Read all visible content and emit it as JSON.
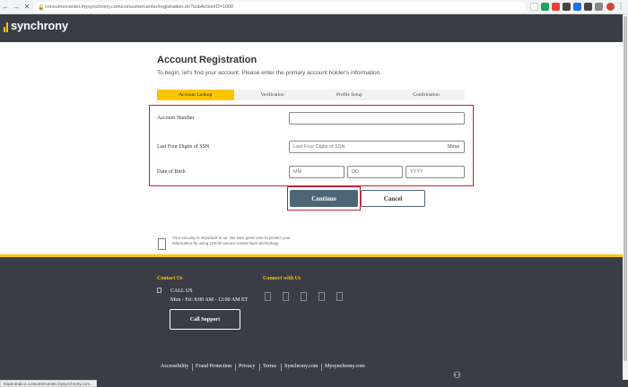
{
  "browser": {
    "url": "consumercenter.mysynchrony.com/consumercenter/registration.do?subActionID=1000",
    "back_icon": "arrow-left",
    "forward_icon": "arrow-right",
    "close_icon": "x"
  },
  "brand": {
    "logo_text": "synchrony",
    "accent": "#fbc600",
    "header_bg": "#3b3d46"
  },
  "page": {
    "title": "Account Registration",
    "subtitle": "To begin, let's find your account. Please enter the primary account holder's information."
  },
  "steps": [
    "Account Lookup",
    "Verification",
    "Profile Setup",
    "Confirmation"
  ],
  "form": {
    "account_number_label": "Account Number",
    "account_number_value": "",
    "ssn_label": "Last Four Digits of SSN",
    "ssn_placeholder": "Last Four Digits of SSN",
    "ssn_show": "Show",
    "dob_label": "Date of Birth",
    "dob_mm": "MM",
    "dob_dd": "DD",
    "dob_yyyy": "YYYY"
  },
  "buttons": {
    "continue": "Continue",
    "cancel": "Cancel"
  },
  "security_text": "Your security is important to us. We take great care to protect your information by using 128-bit secure socket layer technology.",
  "footer": {
    "contact_heading": "Contact Us",
    "connect_heading": "Connect with Us",
    "call_us": "CALL US",
    "hours": "Mon - Fri: 8:00 AM - 12:00 AM ET",
    "call_support": "Call Support",
    "links": [
      "Accessibility",
      "Fraud Protection",
      "Privacy",
      "Terms",
      "Synchrony.com",
      "Mysynchrony.com"
    ]
  },
  "status_bar": "Esperando a consumercenter.mysynchrony.com..."
}
